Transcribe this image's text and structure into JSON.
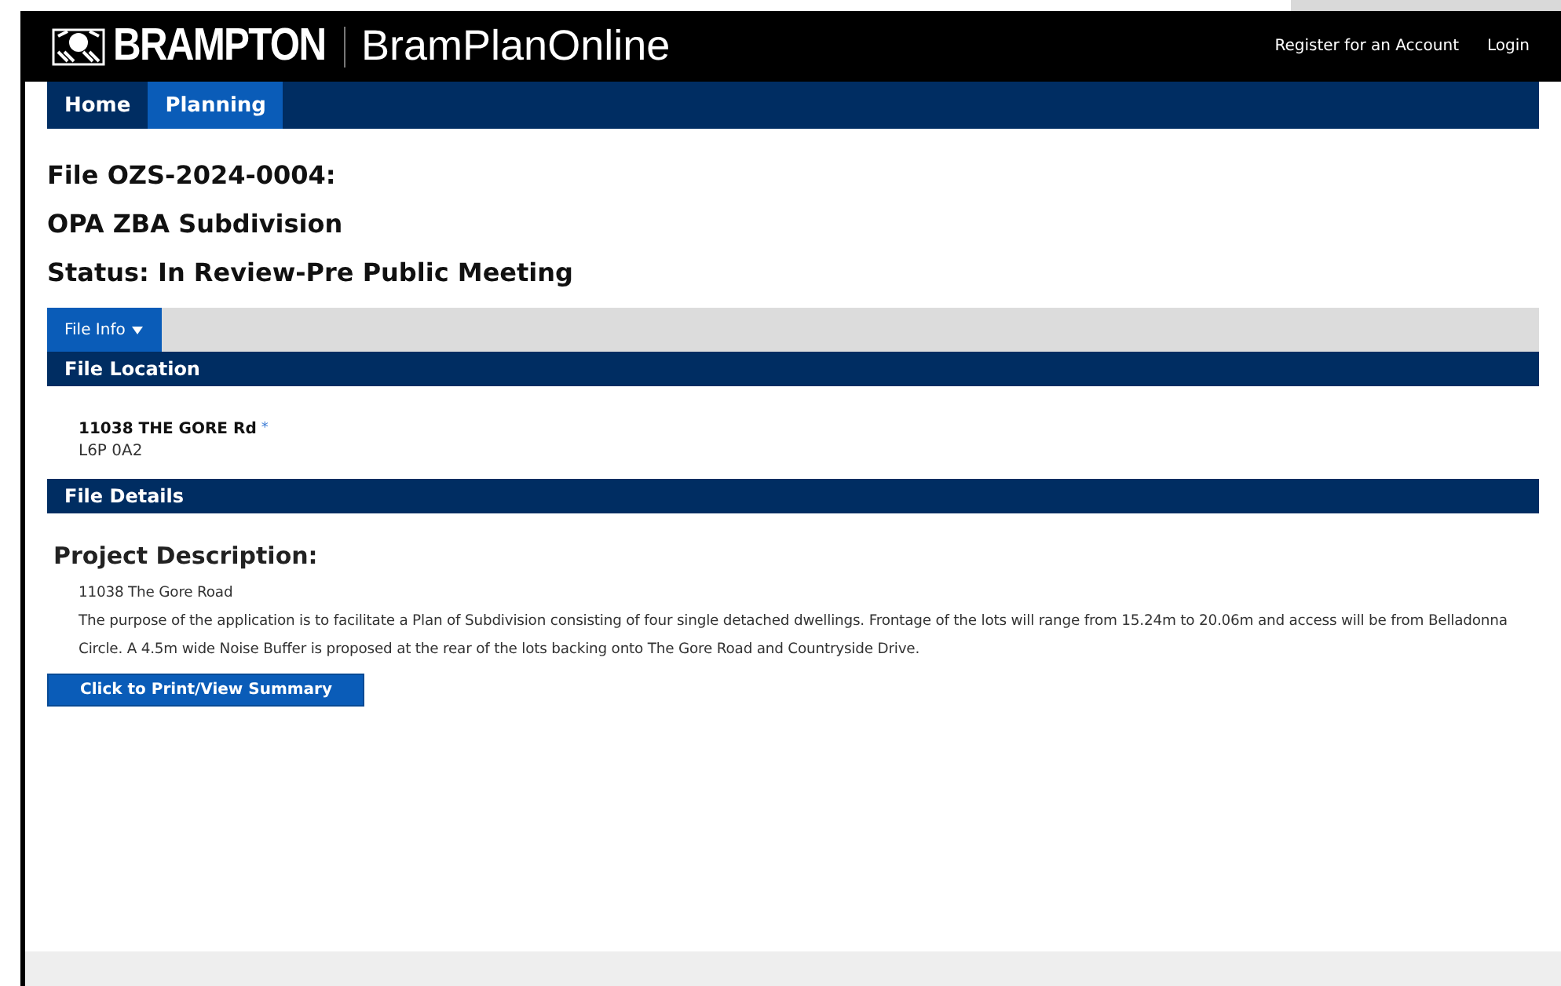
{
  "header": {
    "logo_text": "BRAMPTON",
    "app_name": "BramPlanOnline",
    "links": [
      "Register for an Account",
      "Login"
    ]
  },
  "nav": [
    {
      "label": "Home",
      "selected": false
    },
    {
      "label": "Planning",
      "selected": true
    }
  ],
  "headings": [
    "File OZS-2024-0004:",
    "OPA ZBA Subdivision",
    "Status: In Review-Pre Public Meeting"
  ],
  "tabs": [
    {
      "label": "File Info",
      "selected": true
    }
  ],
  "file_location": {
    "title": "File Location",
    "address": "11038 THE GORE Rd",
    "address_marker": "*",
    "postal_code": "L6P 0A2"
  },
  "file_details": {
    "title": "File Details",
    "description_title": "Project Description:",
    "lines": [
      "11038 The Gore Road",
      "The purpose of the application is to facilitate a Plan of Subdivision consisting of four single detached dwellings. Frontage of the lots will range from 15.24m to 20.06m and access will be from Belladonna Circle. A 4.5m wide Noise Buffer is proposed at the rear of the lots backing onto The Gore Road and Countryside Drive."
    ],
    "button": "Click to Print/View Summary"
  }
}
